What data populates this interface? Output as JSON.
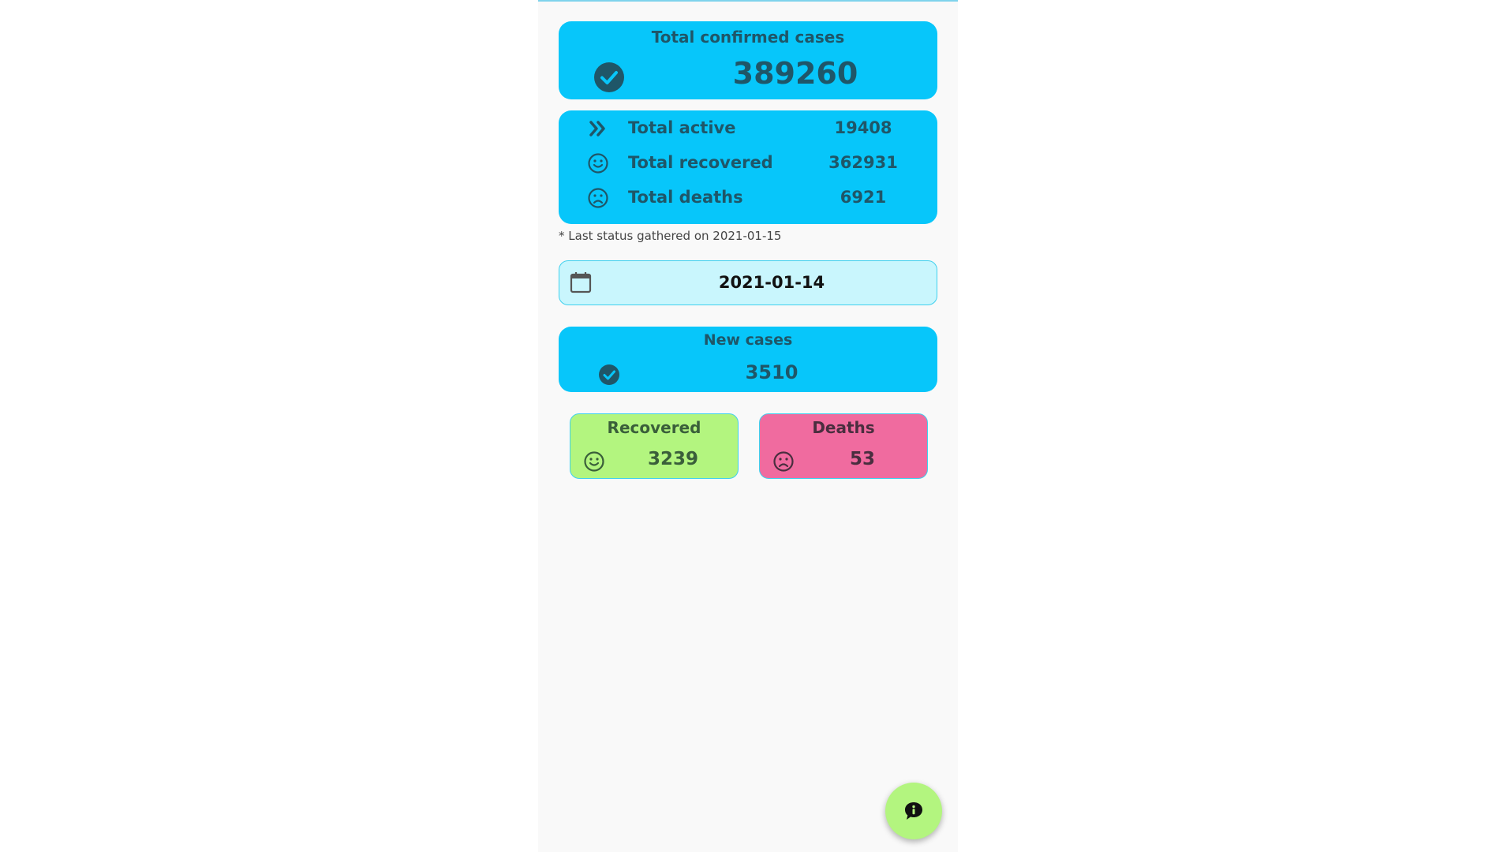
{
  "colors": {
    "card_blue": "#07c6fa",
    "text_dark_teal": "#1f5668",
    "recovered_green": "#b3f57f",
    "deaths_pink": "#f06b9f",
    "date_bg": "#c9f6fd",
    "fab_green": "#b3f57f"
  },
  "total": {
    "title": "Total confirmed cases",
    "value": "389260",
    "icon": "check-circle-icon"
  },
  "stats": [
    {
      "icon": "double-chevron-right-icon",
      "label": "Total active",
      "value": "19408"
    },
    {
      "icon": "smile-icon",
      "label": "Total recovered",
      "value": "362931"
    },
    {
      "icon": "sad-icon",
      "label": "Total deaths",
      "value": "6921"
    }
  ],
  "note": "* Last status gathered on 2021-01-15",
  "date_picker": {
    "icon": "calendar-icon",
    "value": "2021-01-14"
  },
  "new_cases": {
    "title": "New cases",
    "value": "3510",
    "icon": "check-circle-icon"
  },
  "recovered": {
    "title": "Recovered",
    "value": "3239",
    "icon": "smile-icon"
  },
  "deaths": {
    "title": "Deaths",
    "value": "53",
    "icon": "sad-icon"
  },
  "fab": {
    "icon": "info-chat-icon"
  }
}
